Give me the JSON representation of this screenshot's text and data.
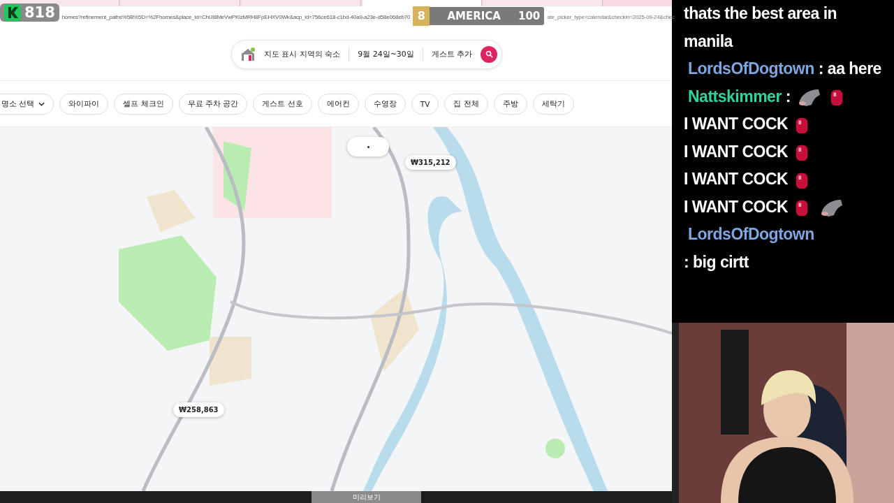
{
  "overlay": {
    "score_badge": "818",
    "rank": "8",
    "region": "AMERICA",
    "points": "100"
  },
  "browser": {
    "tabs": [
      {
        "selected": false
      },
      {
        "selected": false
      },
      {
        "selected": false
      },
      {
        "selected": true
      },
      {
        "selected": false
      }
    ],
    "url_left": "homes?refinement_paths%5B%5D=%2Fhomes&place_id=ChIJi8MeVwPKlzMRH8FpEHXV0Wk&acp_id=756ce618-c1bd-40a9-a23e-d58e068eb70",
    "url_right": "ate_picker_type=calendar&checkin=2025-09-24&chec"
  },
  "search": {
    "location": "지도 표시 지역의 숙소",
    "dates": "9월 24일~30일",
    "guests": "게스트 추가"
  },
  "filters": [
    {
      "label": "명소 선택",
      "dropdown": true
    },
    {
      "label": "와이파이",
      "dropdown": false
    },
    {
      "label": "셀프 체크인",
      "dropdown": false
    },
    {
      "label": "무료 주차 공간",
      "dropdown": false
    },
    {
      "label": "게스트 선호",
      "dropdown": false
    },
    {
      "label": "에어컨",
      "dropdown": false
    },
    {
      "label": "수영장",
      "dropdown": false
    },
    {
      "label": "TV",
      "dropdown": false
    },
    {
      "label": "집 전체",
      "dropdown": false
    },
    {
      "label": "주방",
      "dropdown": false
    },
    {
      "label": "세탁기",
      "dropdown": false
    }
  ],
  "map": {
    "kind": "picture",
    "price_markers": [
      {
        "label": "₩315,212"
      },
      {
        "label": "₩258,863"
      }
    ]
  },
  "bottom_bar": {
    "preview_tab": "미리보기"
  },
  "chat": [
    {
      "parts": [
        {
          "kind": "text",
          "text": "thats the best area in manila"
        }
      ]
    },
    {
      "user": "LordsOfDogtown",
      "color": "#7ea6e0",
      "parts": [
        {
          "kind": "text",
          "text": ": aa here"
        }
      ]
    },
    {
      "user": "Nattskimmer",
      "color": "#2fd3a0",
      "parts": [
        {
          "kind": "text",
          "text": ":"
        },
        {
          "kind": "fish_emote"
        },
        {
          "kind": "red_emote"
        },
        {
          "kind": "text",
          "text": "I WANT COCK"
        },
        {
          "kind": "red_emote"
        },
        {
          "kind": "text",
          "text": "I WANT COCK"
        },
        {
          "kind": "red_emote"
        },
        {
          "kind": "text",
          "text": "I WANT COCK"
        },
        {
          "kind": "red_emote"
        },
        {
          "kind": "text",
          "text": "I WANT COCK"
        },
        {
          "kind": "red_emote"
        },
        {
          "kind": "fish_emote"
        }
      ]
    },
    {
      "user": "LordsOfDogtown",
      "color": "#7ea6e0",
      "parts": [
        {
          "kind": "text",
          "text": ": big cirtt"
        }
      ]
    }
  ]
}
